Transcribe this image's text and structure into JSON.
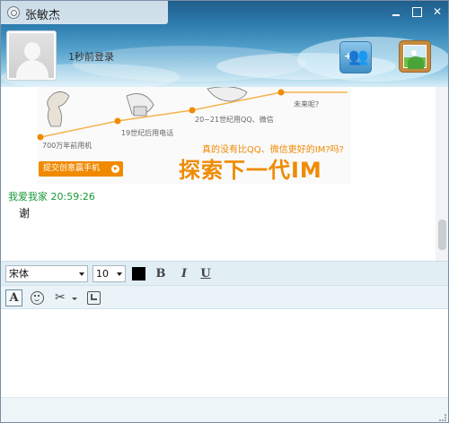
{
  "window": {
    "contact_name": "张敏杰",
    "status_text": "1秒前登录"
  },
  "icons": {
    "title": "qq-contact-icon",
    "minimize": "minimize-icon",
    "maximize": "maximize-icon",
    "close": "close-icon",
    "add_contacts": "add-contacts-icon",
    "picture": "picture-icon",
    "font": "font-icon",
    "emoji": "smiley-icon",
    "cut": "scissors-icon",
    "screenshot": "screenshot-icon"
  },
  "header": {
    "close_glyph": "✕"
  },
  "banner": {
    "milestone_700": "700万年前用机",
    "milestone_19": "19世纪后用电话",
    "milestone_2021": "20~21世纪用QQ、微信",
    "milestone_future": "未来呢?",
    "question": "真的没有比QQ、微信更好的IM?吗?",
    "headline": "探索下一代IM",
    "button_label": "提交创意赢手机"
  },
  "messages": [
    {
      "sender": "我爱我家",
      "time": "20:59:26",
      "text": "谢"
    }
  ],
  "format": {
    "font_family": "宋体",
    "font_size": "10",
    "bold": "B",
    "italic": "I",
    "underline": "U",
    "text_color": "#000000"
  },
  "tools": {
    "font_glyph": "A",
    "cut_glyph": "✂"
  },
  "colors": {
    "sender": "#1a9a3a",
    "accent": "#f08a00"
  }
}
